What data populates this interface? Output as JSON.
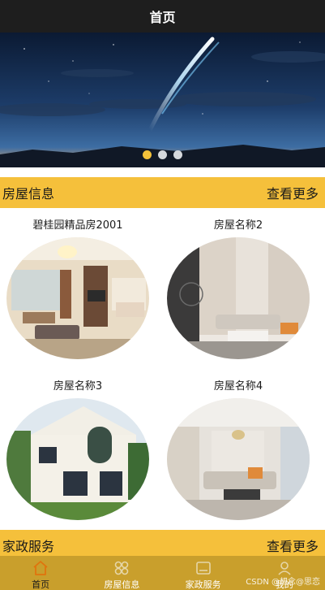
{
  "navbar": {
    "title": "首页"
  },
  "banner": {
    "dots": [
      {
        "active": true
      },
      {
        "active": false
      },
      {
        "active": false
      }
    ]
  },
  "houses_section": {
    "title": "房屋信息",
    "more": "查看更多",
    "items": [
      {
        "name": "碧桂园精品房2001"
      },
      {
        "name": "房屋名称2"
      },
      {
        "name": "房屋名称3"
      },
      {
        "name": "房屋名称4"
      }
    ]
  },
  "housekeeping_section": {
    "title": "家政服务",
    "more": "查看更多"
  },
  "tabbar": {
    "tabs": [
      {
        "label": "首页",
        "icon": "home-icon",
        "active": true
      },
      {
        "label": "房屋信息",
        "icon": "grid-icon",
        "active": false
      },
      {
        "label": "家政服务",
        "icon": "service-icon",
        "active": false
      },
      {
        "label": "我的",
        "icon": "user-icon",
        "active": false
      }
    ]
  },
  "watermark": "CSDN @想念@思恋",
  "colors": {
    "accent": "#f5c03b",
    "navbar": "#1e1e1e",
    "tabbar": "#c99f2c",
    "tab_active": "#e0740d"
  }
}
